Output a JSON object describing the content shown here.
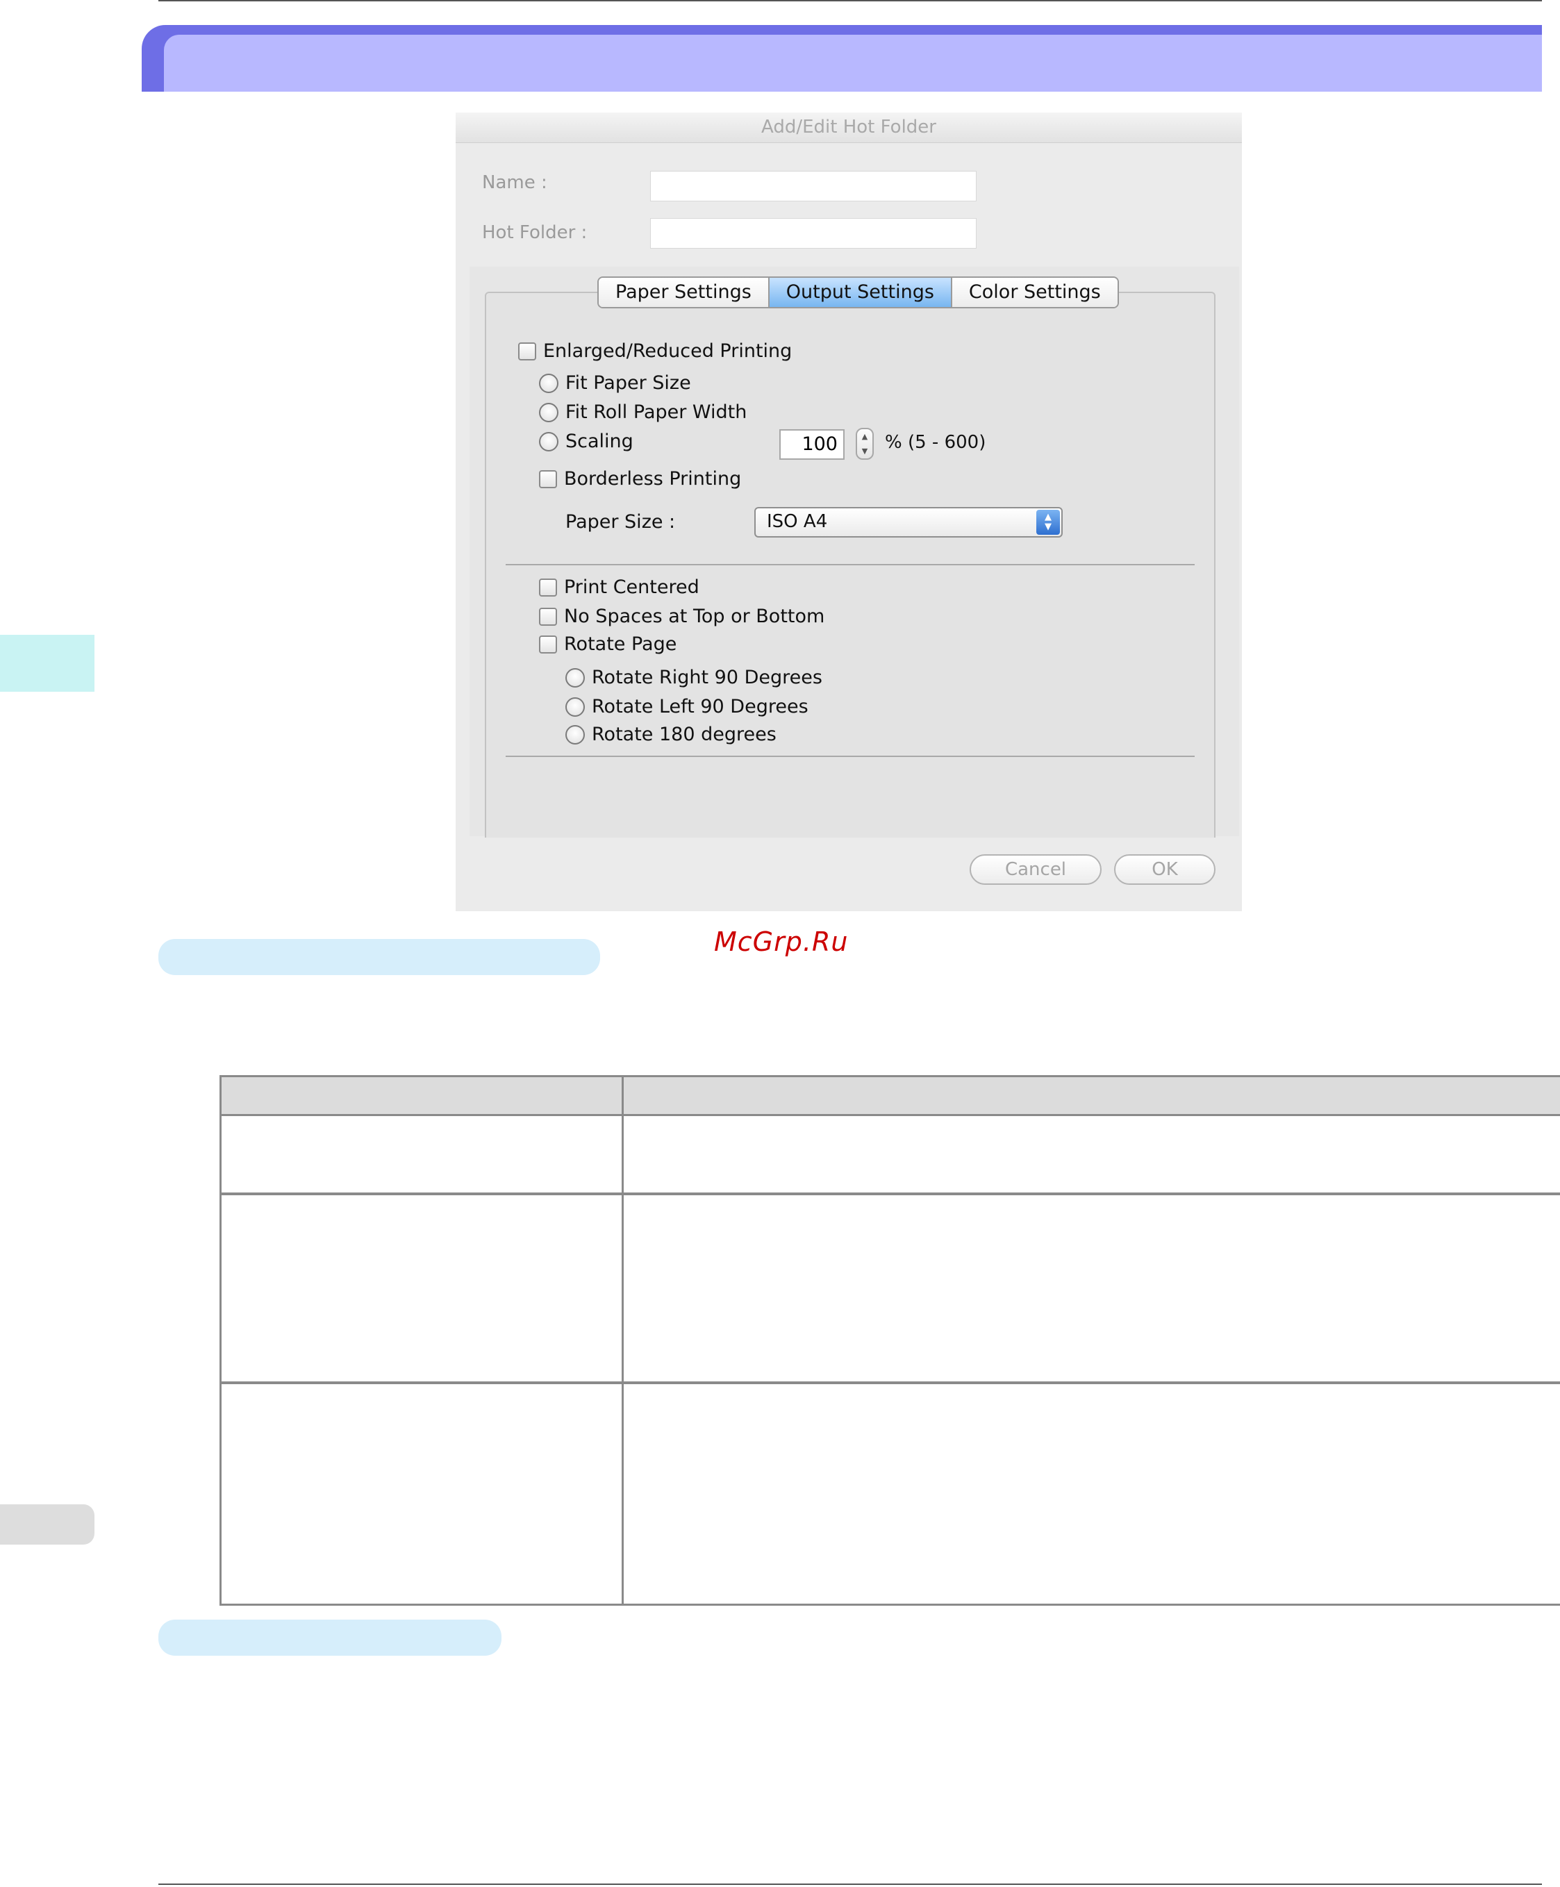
{
  "dialog": {
    "title": "Add/Edit Hot Folder",
    "name_label": "Name :",
    "name_value": "",
    "hot_folder_label": "Hot Folder :",
    "hot_folder_value": "",
    "tabs": [
      {
        "label": "Paper Settings",
        "active": false
      },
      {
        "label": "Output Settings",
        "active": true
      },
      {
        "label": "Color Settings",
        "active": false
      }
    ],
    "output": {
      "enlarged_reduced": "Enlarged/Reduced Printing",
      "fit_paper_size": "Fit Paper Size",
      "fit_roll_paper_width": "Fit Roll Paper Width",
      "scaling": "Scaling",
      "scaling_value": "100",
      "scaling_range": "% (5 - 600)",
      "borderless": "Borderless Printing",
      "paper_size_label": "Paper Size :",
      "paper_size_value": "ISO A4",
      "print_centered": "Print Centered",
      "no_spaces": "No Spaces at Top or Bottom",
      "rotate_page": "Rotate Page",
      "rotate_right": "Rotate Right 90 Degrees",
      "rotate_left": "Rotate Left 90 Degrees",
      "rotate_180": "Rotate 180 degrees"
    },
    "buttons": {
      "cancel": "Cancel",
      "ok": "OK"
    }
  },
  "watermark": "McGrp.Ru",
  "colors": {
    "banner_dark": "#6e6ee6",
    "banner_light": "#b8b8ff",
    "pill": "#d6eefb",
    "tab_active": "#78b6f0",
    "watermark": "#cc0000"
  }
}
